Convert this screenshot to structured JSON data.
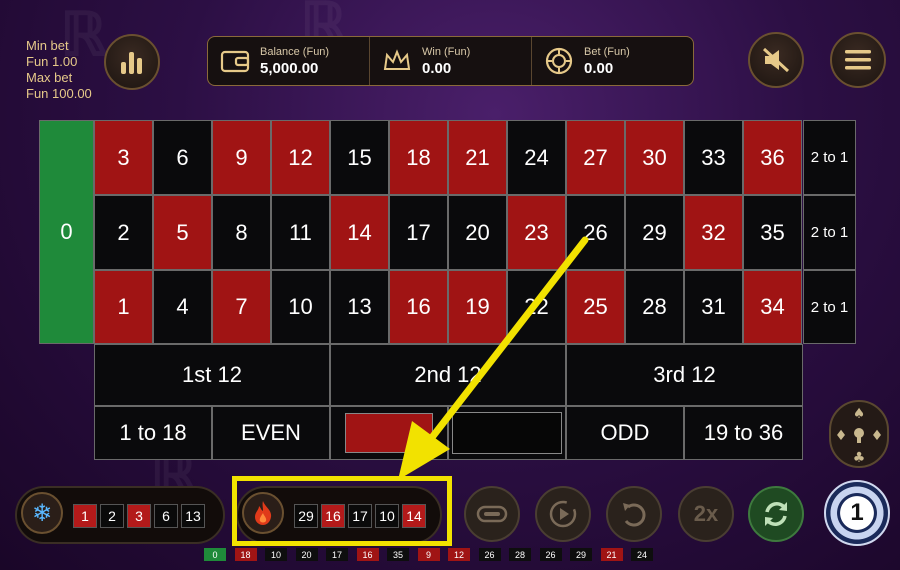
{
  "bet_limits": {
    "min_label": "Min bet",
    "min_value": "Fun 1.00",
    "max_label": "Max bet",
    "max_value": "Fun 100.00"
  },
  "info": {
    "balance_label": "Balance (Fun)",
    "balance_value": "5,000.00",
    "win_label": "Win (Fun)",
    "win_value": "0.00",
    "bet_label": "Bet (Fun)",
    "bet_value": "0.00"
  },
  "icons": {
    "stats": "stats-icon",
    "mute": "mute-icon",
    "menu": "menu-icon",
    "wallet": "wallet-icon",
    "crown": "crown-icon",
    "chip": "chip-icon",
    "snowflake": "snowflake-icon",
    "fire": "fire-icon",
    "racetrack": "racetrack-icon",
    "auto": "autoplay-icon",
    "undo": "undo-icon",
    "repeat": "repeat-icon",
    "suits": "card-suits-icon"
  },
  "table": {
    "zero": "0",
    "rows": [
      [
        {
          "n": "3",
          "c": "red"
        },
        {
          "n": "6",
          "c": "black"
        },
        {
          "n": "9",
          "c": "red"
        },
        {
          "n": "12",
          "c": "red"
        },
        {
          "n": "15",
          "c": "black"
        },
        {
          "n": "18",
          "c": "red"
        },
        {
          "n": "21",
          "c": "red"
        },
        {
          "n": "24",
          "c": "black"
        },
        {
          "n": "27",
          "c": "red"
        },
        {
          "n": "30",
          "c": "red"
        },
        {
          "n": "33",
          "c": "black"
        },
        {
          "n": "36",
          "c": "red"
        }
      ],
      [
        {
          "n": "2",
          "c": "black"
        },
        {
          "n": "5",
          "c": "red"
        },
        {
          "n": "8",
          "c": "black"
        },
        {
          "n": "11",
          "c": "black"
        },
        {
          "n": "14",
          "c": "red"
        },
        {
          "n": "17",
          "c": "black"
        },
        {
          "n": "20",
          "c": "black"
        },
        {
          "n": "23",
          "c": "red"
        },
        {
          "n": "26",
          "c": "black"
        },
        {
          "n": "29",
          "c": "black"
        },
        {
          "n": "32",
          "c": "red"
        },
        {
          "n": "35",
          "c": "black"
        }
      ],
      [
        {
          "n": "1",
          "c": "red"
        },
        {
          "n": "4",
          "c": "black"
        },
        {
          "n": "7",
          "c": "red"
        },
        {
          "n": "10",
          "c": "black"
        },
        {
          "n": "13",
          "c": "black"
        },
        {
          "n": "16",
          "c": "red"
        },
        {
          "n": "19",
          "c": "red"
        },
        {
          "n": "22",
          "c": "black"
        },
        {
          "n": "25",
          "c": "red"
        },
        {
          "n": "28",
          "c": "black"
        },
        {
          "n": "31",
          "c": "black"
        },
        {
          "n": "34",
          "c": "red"
        }
      ]
    ],
    "column_bets": [
      "2 to 1",
      "2 to 1",
      "2 to 1"
    ],
    "dozens": [
      "1st 12",
      "2nd 12",
      "3rd 12"
    ],
    "even_money": {
      "low": "1 to 18",
      "even": "EVEN",
      "red": "",
      "black": "",
      "odd": "ODD",
      "high": "19 to 36"
    }
  },
  "cold_numbers": [
    {
      "n": "1",
      "c": "r"
    },
    {
      "n": "2",
      "c": "b"
    },
    {
      "n": "3",
      "c": "r"
    },
    {
      "n": "6",
      "c": "b"
    },
    {
      "n": "13",
      "c": "b"
    }
  ],
  "hot_numbers": [
    {
      "n": "29",
      "c": "b"
    },
    {
      "n": "16",
      "c": "r"
    },
    {
      "n": "17",
      "c": "b"
    },
    {
      "n": "10",
      "c": "b"
    },
    {
      "n": "14",
      "c": "r"
    }
  ],
  "controls": {
    "double_label": "2x",
    "chip_value": "1"
  },
  "recent_results": [
    {
      "n": "0",
      "c": "g"
    },
    {
      "n": "18",
      "c": "r"
    },
    {
      "n": "10",
      "c": "b"
    },
    {
      "n": "20",
      "c": "b"
    },
    {
      "n": "17",
      "c": "b"
    },
    {
      "n": "16",
      "c": "r"
    },
    {
      "n": "35",
      "c": "b"
    },
    {
      "n": "9",
      "c": "r"
    },
    {
      "n": "12",
      "c": "r"
    },
    {
      "n": "26",
      "c": "b"
    },
    {
      "n": "28",
      "c": "b"
    },
    {
      "n": "26",
      "c": "b"
    },
    {
      "n": "29",
      "c": "b"
    },
    {
      "n": "21",
      "c": "r"
    },
    {
      "n": "24",
      "c": "b"
    }
  ],
  "colors": {
    "accent": "#e6c989",
    "red": "#a01414",
    "black": "#0a0a0c",
    "green": "#1f8a3a",
    "highlight": "#f2e200"
  }
}
